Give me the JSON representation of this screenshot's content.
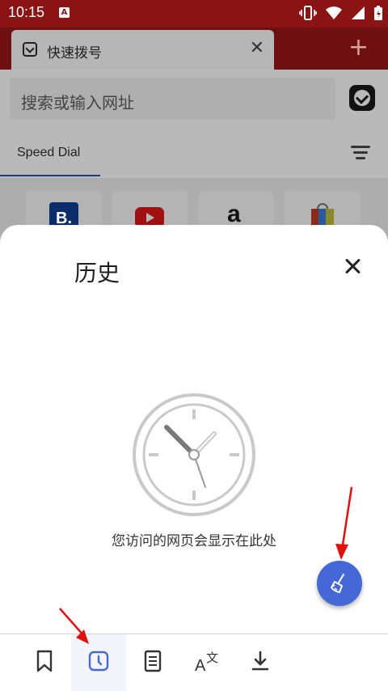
{
  "status_bar": {
    "time": "10:15",
    "notification_badge": "A"
  },
  "tab_bar": {
    "active_tab_title": "快速拨号",
    "new_tab_symbol": "+"
  },
  "address_bar": {
    "placeholder": "搜索或输入网址"
  },
  "speed_dial": {
    "tab_label": "Speed Dial",
    "tiles": [
      {
        "icon": "booking-icon",
        "label": "B."
      },
      {
        "icon": "youtube-icon",
        "label": ""
      },
      {
        "icon": "amazon-icon",
        "label": "a"
      },
      {
        "icon": "shopping-bag-icon",
        "label": ""
      }
    ]
  },
  "history_panel": {
    "title": "历史",
    "empty_message": "您访问的网页会显示在此处"
  },
  "bottom_nav": {
    "items": [
      {
        "icon": "bookmark-icon",
        "active": false
      },
      {
        "icon": "history-icon",
        "active": true
      },
      {
        "icon": "notes-icon",
        "active": false
      },
      {
        "icon": "translate-icon",
        "active": false
      },
      {
        "icon": "download-icon",
        "active": false
      }
    ]
  },
  "colors": {
    "tab_bar_red": "#8a1414",
    "accent_blue": "#4568d6",
    "overlay_gray": "#b9b9b9"
  }
}
